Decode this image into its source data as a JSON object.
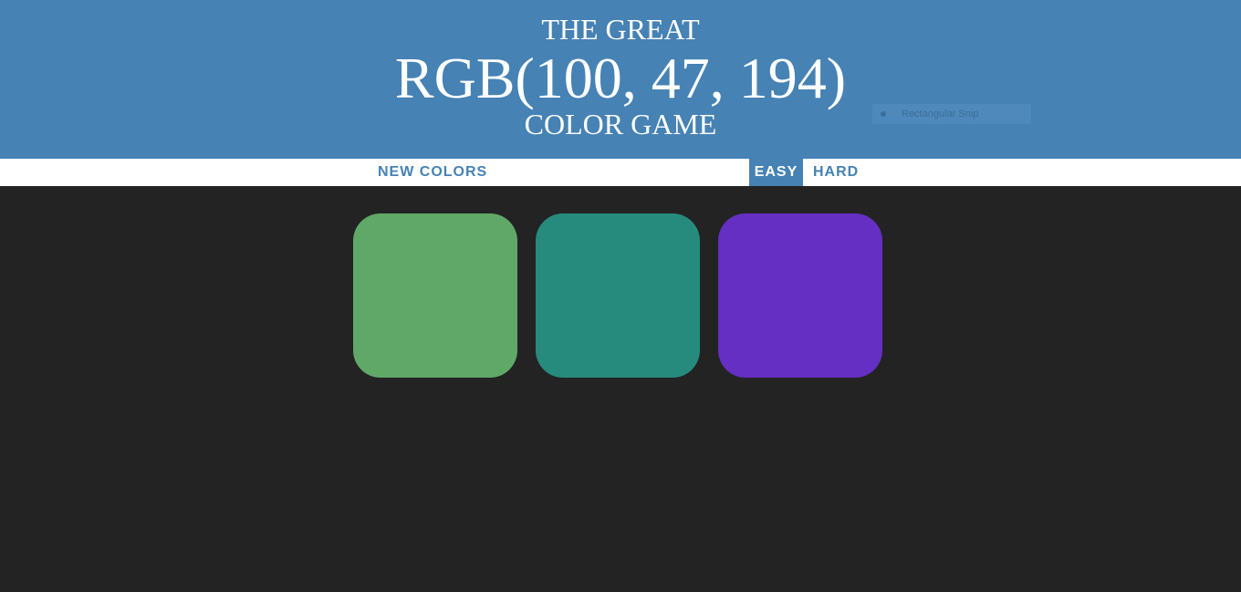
{
  "header": {
    "line1": "THE GREAT",
    "color_display": "RGB(100, 47, 194)",
    "line3": "COLOR GAME",
    "background": "#4682b4"
  },
  "snip_overlay": {
    "label": "Rectangular Snip"
  },
  "controls": {
    "new_colors_label": "NEW COLORS",
    "easy_label": "EASY",
    "hard_label": "HARD",
    "selected_mode": "EASY"
  },
  "squares": [
    {
      "color": "#60a868"
    },
    {
      "color": "#268b7d"
    },
    {
      "color": "#642fc2"
    }
  ],
  "board_background": "#232323"
}
